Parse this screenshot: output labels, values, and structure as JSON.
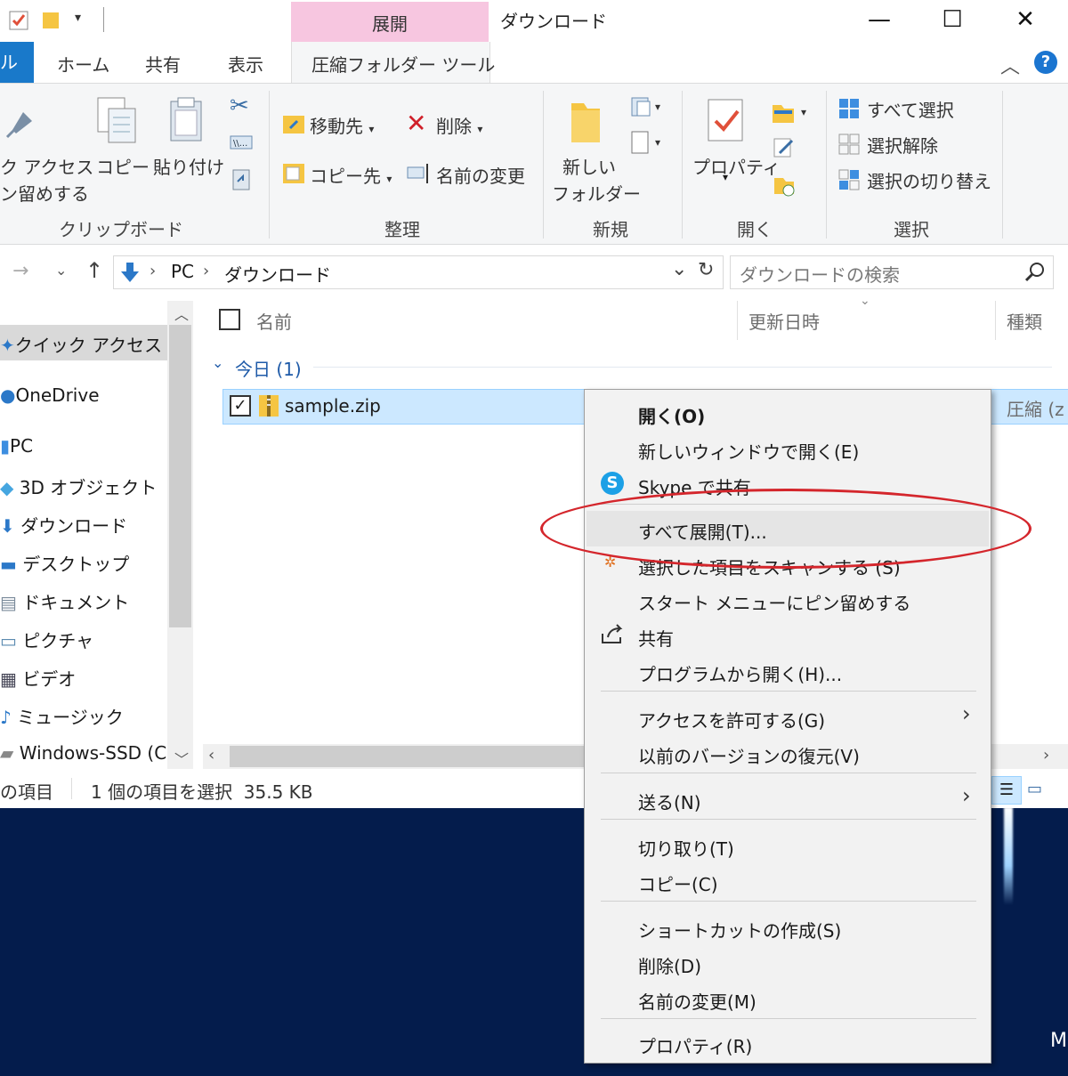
{
  "window": {
    "context_tab": "展開",
    "title": "ダウンロード",
    "controls": {
      "minimize": "—",
      "maximize": "☐",
      "close": "✕"
    }
  },
  "tabs": {
    "file": "ル",
    "home": "ホーム",
    "share": "共有",
    "view": "表示",
    "compressed": "圧縮フォルダー ツール"
  },
  "ribbon": {
    "quick_access_1": "ク アクセス",
    "quick_access_2": "ン留めする",
    "copy": "コピー",
    "paste": "貼り付け",
    "group_clipboard": "クリップボード",
    "move_to": "移動先",
    "copy_to": "コピー先",
    "delete": "削除",
    "rename": "名前の変更",
    "group_organize": "整理",
    "new_folder_1": "新しい",
    "new_folder_2": "フォルダー",
    "group_new": "新規",
    "properties": "プロパティ",
    "group_open": "開く",
    "select_all": "すべて選択",
    "select_none": "選択解除",
    "invert_selection": "選択の切り替え",
    "group_select": "選択"
  },
  "address": {
    "pc": "PC",
    "downloads": "ダウンロード",
    "search_placeholder": "ダウンロードの検索"
  },
  "nav": {
    "quick_access": "クイック アクセス",
    "onedrive": "OneDrive",
    "pc": "PC",
    "objects3d": "3D オブジェクト",
    "downloads": "ダウンロード",
    "desktop": "デスクトップ",
    "documents": "ドキュメント",
    "pictures": "ピクチャ",
    "videos": "ビデオ",
    "music": "ミュージック",
    "drive": "Windows-SSD (C"
  },
  "content": {
    "col_name": "名前",
    "col_date": "更新日時",
    "col_type": "種類",
    "group_today": "今日 (1)",
    "file_name": "sample.zip",
    "file_type": "圧縮 (z"
  },
  "status": {
    "items": "の項目",
    "selected": "1 個の項目を選択  35.5 KB"
  },
  "context_menu": {
    "open": "開く(O)",
    "open_new_window": "新しいウィンドウで開く(E)",
    "skype_share": "Skype で共有",
    "extract_all": "すべて展開(T)...",
    "scan": "選択した項目をスキャンする (S)",
    "pin_start": "スタート メニューにピン留めする",
    "share": "共有",
    "open_with": "プログラムから開く(H)...",
    "give_access": "アクセスを許可する(G)",
    "restore_versions": "以前のバージョンの復元(V)",
    "send_to": "送る(N)",
    "cut": "切り取り(T)",
    "copy": "コピー(C)",
    "create_shortcut": "ショートカットの作成(S)",
    "delete": "削除(D)",
    "rename": "名前の変更(M)",
    "properties": "プロパティ(R)"
  },
  "desktop": {
    "corner_text": "M"
  }
}
